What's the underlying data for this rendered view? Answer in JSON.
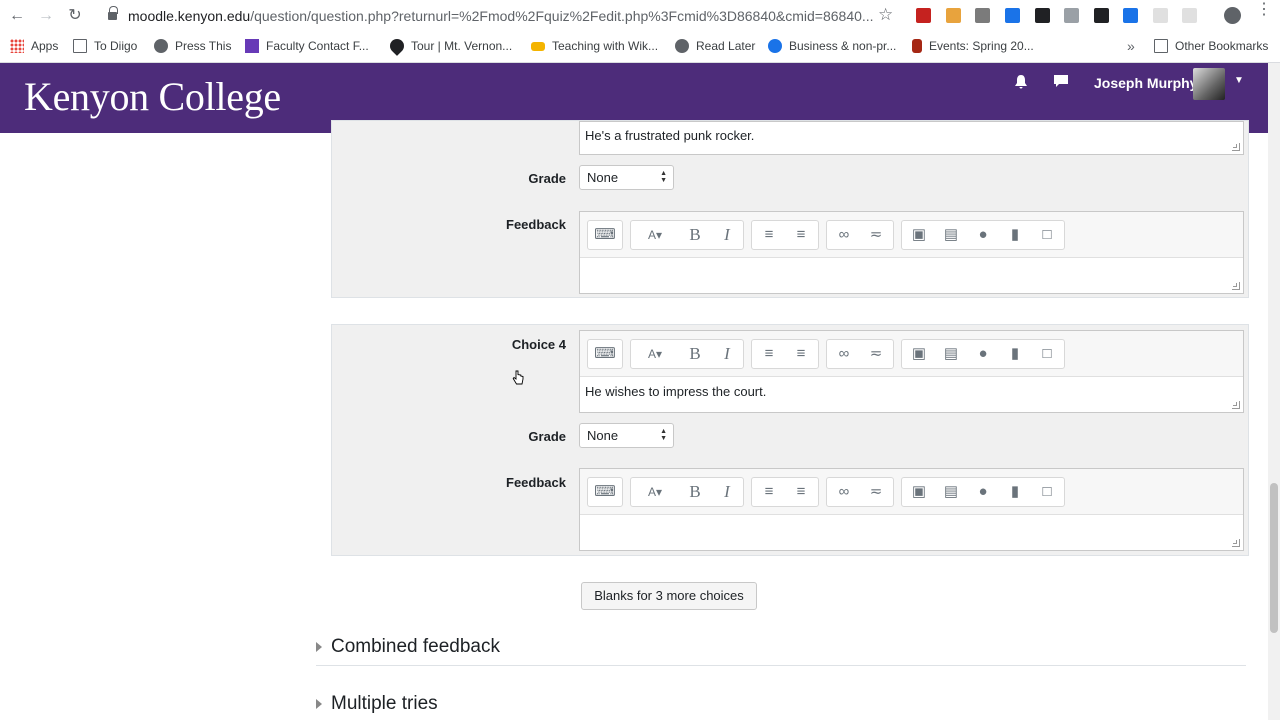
{
  "browser": {
    "url_host": "moodle.kenyon.edu",
    "url_path": "/question/question.php?returnurl=%2Fmod%2Fquiz%2Fedit.php%3Fcmid%3D86840&cmid=86840...",
    "bookmarks": [
      {
        "label": "Apps",
        "icon": "apps-icon"
      },
      {
        "label": "To Diigo",
        "icon": "folder-icon"
      },
      {
        "label": "Press This",
        "icon": "globe-icon"
      },
      {
        "label": "Faculty Contact F...",
        "icon": "form-icon"
      },
      {
        "label": "Tour | Mt. Vernon...",
        "icon": "pin-icon"
      },
      {
        "label": "Teaching with Wik...",
        "icon": "wiki-icon"
      },
      {
        "label": "Read Later",
        "icon": "globe-icon"
      },
      {
        "label": "Business & non-pr...",
        "icon": "chart-icon"
      },
      {
        "label": "Events: Spring 20...",
        "icon": "bag-icon"
      }
    ],
    "more": "»",
    "other_bookmarks": "Other Bookmarks"
  },
  "header": {
    "logo": "Kenyon College",
    "user_name": "Joseph Murphy"
  },
  "choice3": {
    "partial_text": "He's a frustrated punk rocker.",
    "grade_label": "Grade",
    "grade_value": "None",
    "feedback_label": "Feedback"
  },
  "choice4": {
    "label": "Choice 4",
    "text": "He wishes to impress the court.",
    "grade_label": "Grade",
    "grade_value": "None",
    "feedback_label": "Feedback"
  },
  "blanks_button": "Blanks for 3 more choices",
  "sections": {
    "combined_feedback": "Combined feedback",
    "multiple_tries": "Multiple tries"
  },
  "colors": {
    "header_bg": "#4d2c7a",
    "panel_bg": "#f0f0f0"
  }
}
